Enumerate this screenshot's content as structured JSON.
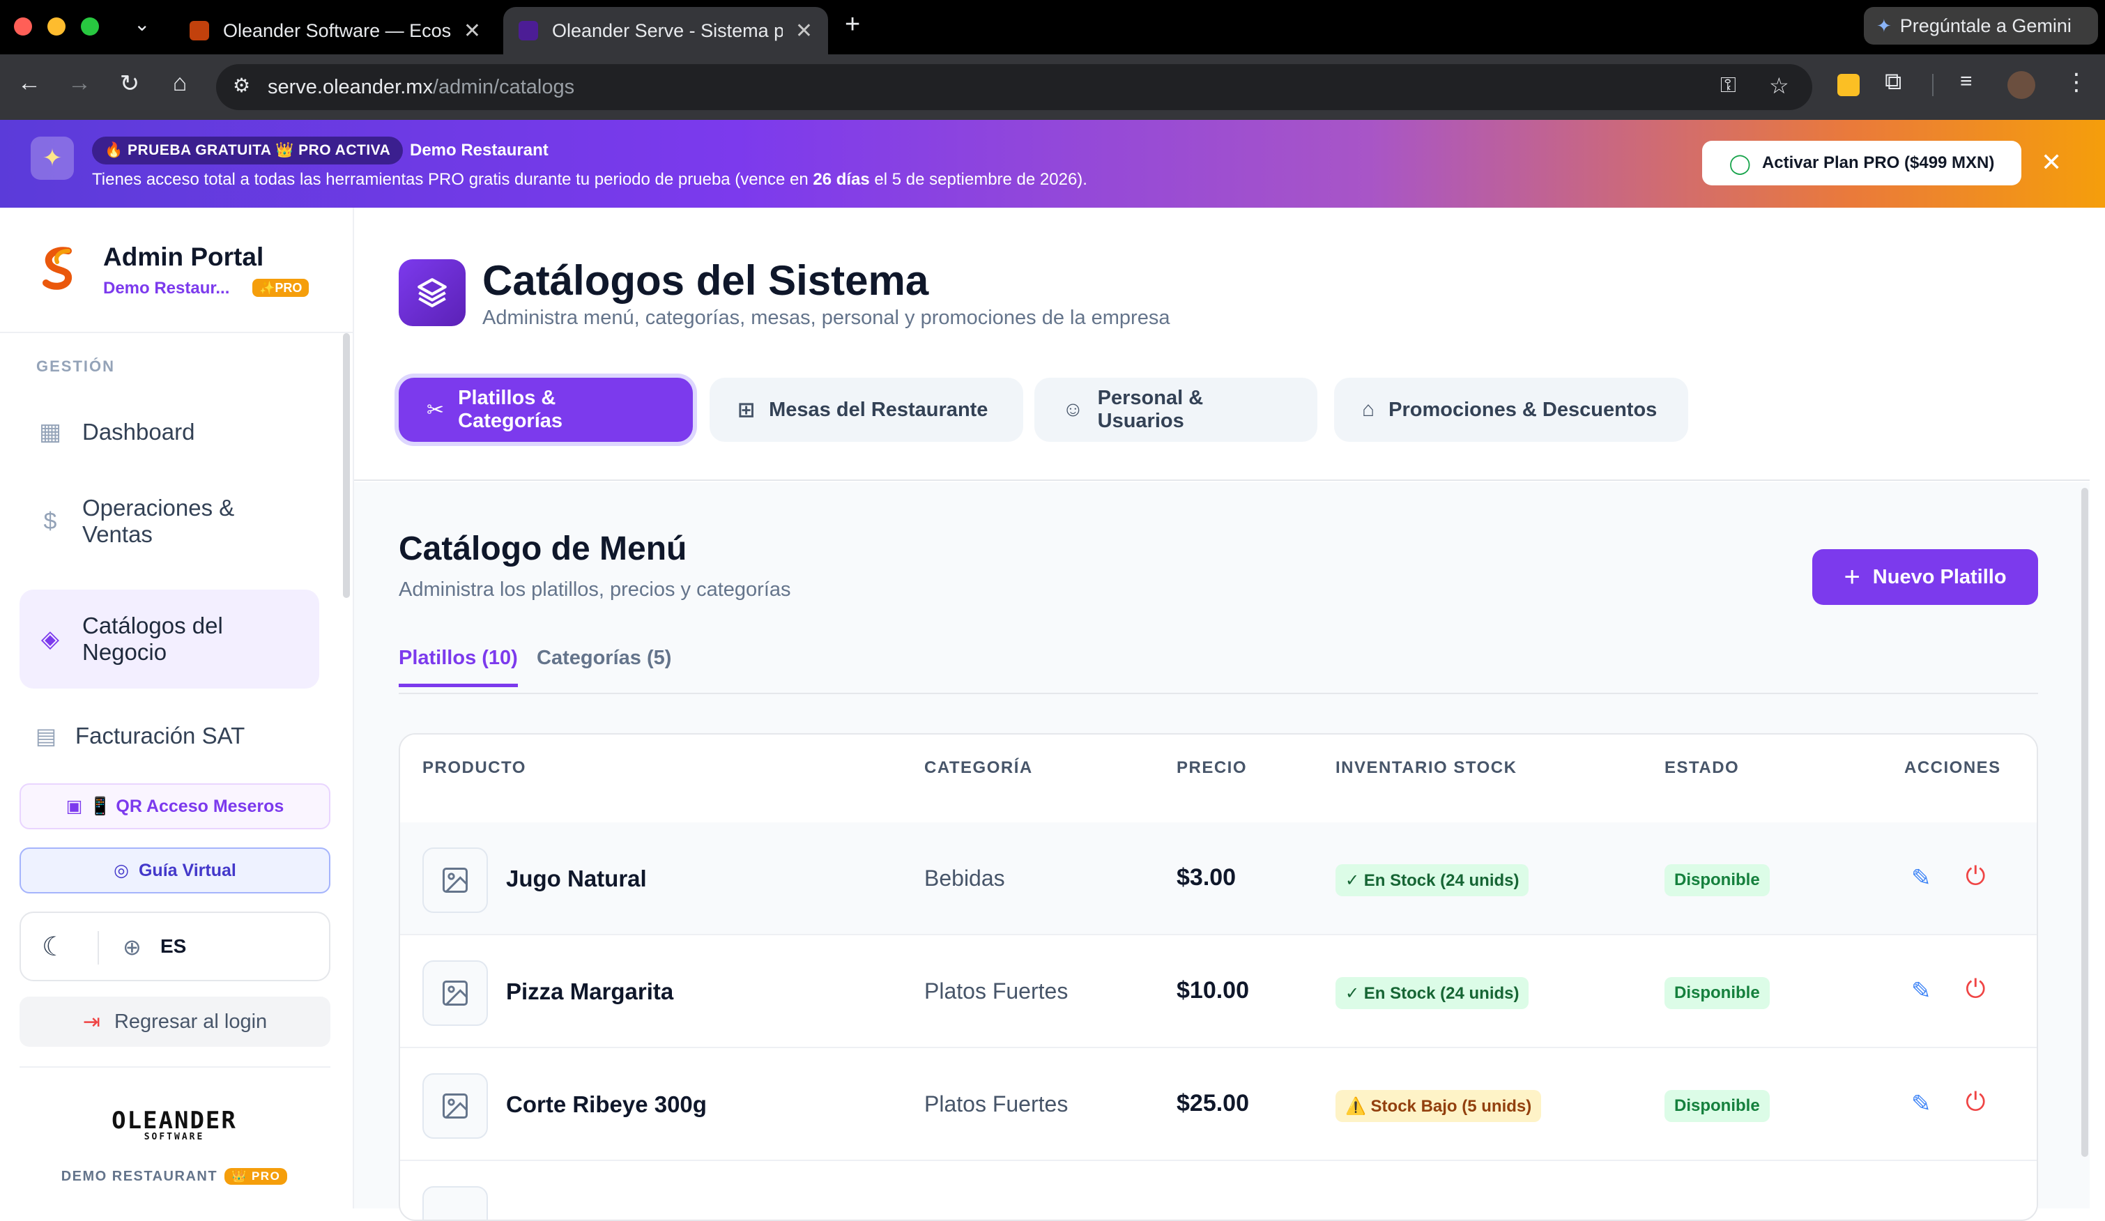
{
  "browser": {
    "tabs": [
      {
        "title": "Oleander Software — Ecosiste"
      },
      {
        "title": "Oleander Serve - Sistema par"
      }
    ],
    "gemini_label": "Pregúntale a Gemini",
    "url_host": "serve.oleander.mx",
    "url_path": "/admin/catalogs"
  },
  "promo": {
    "badge": "🔥 PRUEBA GRATUITA 👑 PRO ACTIVA",
    "restaurant": "Demo Restaurant",
    "message_pre": "Tienes acceso total a todas las herramientas PRO gratis durante tu periodo de prueba (vence en ",
    "days": "26 días",
    "message_post": " el 5 de septiembre de 2026).",
    "cta": "Activar Plan PRO ($499 MXN)"
  },
  "sidebar": {
    "app_name": "Admin Portal",
    "restaurant": "Demo Restaur...",
    "pro_badge": "✨PRO",
    "section": "GESTIÓN",
    "items": [
      {
        "label": "Dashboard"
      },
      {
        "label": "Operaciones &",
        "label2": "Ventas"
      },
      {
        "label": "Catálogos del",
        "label2": "Negocio"
      },
      {
        "label": "Facturación SAT"
      }
    ],
    "qr_button": "📱 QR Acceso Meseros",
    "guide_button": "Guía Virtual",
    "language": "ES",
    "logout": "Regresar al login",
    "brand": "OLEANDER",
    "brand_sub": "SOFTWARE",
    "footer": "DEMO RESTAURANT",
    "footer_badge": "👑 PRO"
  },
  "header": {
    "title": "Catálogos del Sistema",
    "subtitle": "Administra menú, categorías, mesas, personal y promociones de la empresa",
    "tabs": [
      {
        "label": "Platillos & Categorías"
      },
      {
        "label": "Mesas del Restaurante"
      },
      {
        "label": "Personal & Usuarios"
      },
      {
        "label": "Promociones & Descuentos"
      }
    ]
  },
  "catalog": {
    "title": "Catálogo de Menú",
    "subtitle": "Administra los platillos, precios y categorías",
    "new_button": "Nuevo Platillo",
    "subtabs": [
      {
        "label": "Platillos (10)"
      },
      {
        "label": "Categorías (5)"
      }
    ],
    "columns": [
      "PRODUCTO",
      "CATEGORÍA",
      "PRECIO",
      "INVENTARIO STOCK",
      "ESTADO",
      "ACCIONES"
    ],
    "rows": [
      {
        "name": "Jugo Natural",
        "category": "Bebidas",
        "price": "$3.00",
        "stock": "✓ En Stock (24 unids)",
        "stock_level": "ok",
        "status": "Disponible"
      },
      {
        "name": "Pizza Margarita",
        "category": "Platos Fuertes",
        "price": "$10.00",
        "stock": "✓ En Stock (24 unids)",
        "stock_level": "ok",
        "status": "Disponible"
      },
      {
        "name": "Corte Ribeye 300g",
        "category": "Platos Fuertes",
        "price": "$25.00",
        "stock": "⚠️ Stock Bajo (5 unids)",
        "stock_level": "low",
        "status": "Disponible"
      }
    ]
  },
  "colors": {
    "accent": "#7c3aed",
    "success": "#16a34a",
    "warning": "#f59e0b",
    "danger": "#ef4444"
  }
}
